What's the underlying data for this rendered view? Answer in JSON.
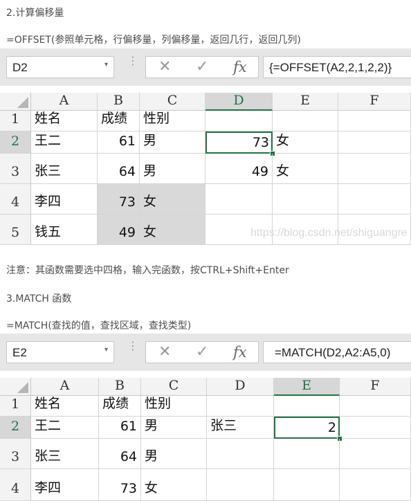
{
  "section1": {
    "heading": "2.计算偏移量",
    "syntax": "=OFFSET(参照单元格，行偏移量，列偏移量，返回几行，返回几列)",
    "name_box": "D2",
    "formula": "{=OFFSET(A2,2,1,2,2)}",
    "columns": [
      "A",
      "B",
      "C",
      "D",
      "E",
      "F"
    ],
    "rows": [
      {
        "num": "1",
        "a": "姓名",
        "b": "成绩",
        "c": "性别",
        "d": "",
        "e": ""
      },
      {
        "num": "2",
        "a": "王二",
        "b": "61",
        "c": "男",
        "d": "73",
        "e": "女"
      },
      {
        "num": "3",
        "a": "张三",
        "b": "64",
        "c": "男",
        "d": "49",
        "e": "女"
      },
      {
        "num": "4",
        "a": "李四",
        "b": "73",
        "c": "女",
        "d": "",
        "e": ""
      },
      {
        "num": "5",
        "a": "钱五",
        "b": "49",
        "c": "女",
        "d": "",
        "e": ""
      }
    ],
    "watermark": "https://blog.csdn.net/shiguangre"
  },
  "note": "注意：其函数需要选中四格，输入完函数，按CTRL+Shift+Enter",
  "section2": {
    "heading": "3.MATCH 函数",
    "syntax": "=MATCH(查找的值，查找区域，查找类型)",
    "name_box": "E2",
    "formula": "=MATCH(D2,A2:A5,0)",
    "columns": [
      "A",
      "B",
      "C",
      "D",
      "E",
      "F"
    ],
    "rows": [
      {
        "num": "1",
        "a": "姓名",
        "b": "成绩",
        "c": "性别",
        "d": "",
        "e": ""
      },
      {
        "num": "2",
        "a": "王二",
        "b": "61",
        "c": "男",
        "d": "张三",
        "e": "2"
      },
      {
        "num": "3",
        "a": "张三",
        "b": "64",
        "c": "男",
        "d": "",
        "e": ""
      },
      {
        "num": "4",
        "a": "李四",
        "b": "73",
        "c": "女",
        "d": "",
        "e": ""
      }
    ]
  },
  "icons": {
    "cancel": "✕",
    "enter": "✓",
    "fx": "fx",
    "dropdown": "▾"
  }
}
